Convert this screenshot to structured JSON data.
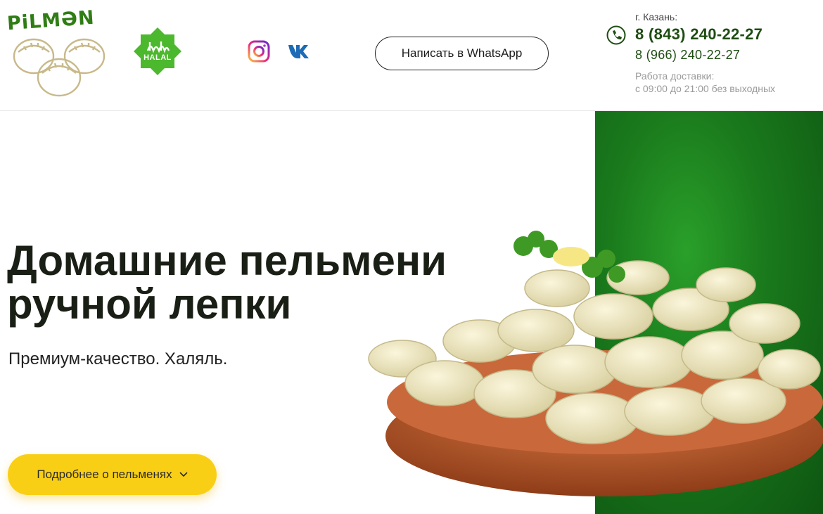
{
  "header": {
    "logo_text": "PiLMƏN",
    "halal_label": "HALAL",
    "social": [
      {
        "name": "instagram",
        "icon": "instagram-icon"
      },
      {
        "name": "vk",
        "icon": "vk-icon"
      }
    ],
    "whatsapp_button": "Написать в WhatsApp",
    "contacts": {
      "city": "г. Казань:",
      "phone_main": "8 (843) 240-22-27",
      "phone_second": "8 (966) 240-22-27",
      "hours_label": "Работа доставки:",
      "hours_value": "с 09:00 до 21:00 без выходных"
    }
  },
  "hero": {
    "headline_line1": "Домашние пельмени",
    "headline_line2": "ручной лепки",
    "subline": "Премиум-качество. Халяль.",
    "more_button": "Подробнее о пельменях"
  },
  "colors": {
    "brand_green": "#2f7d14",
    "phone_green": "#1e4d12",
    "accent_yellow": "#f9cf16",
    "hero_green": "#1a7a1c"
  }
}
